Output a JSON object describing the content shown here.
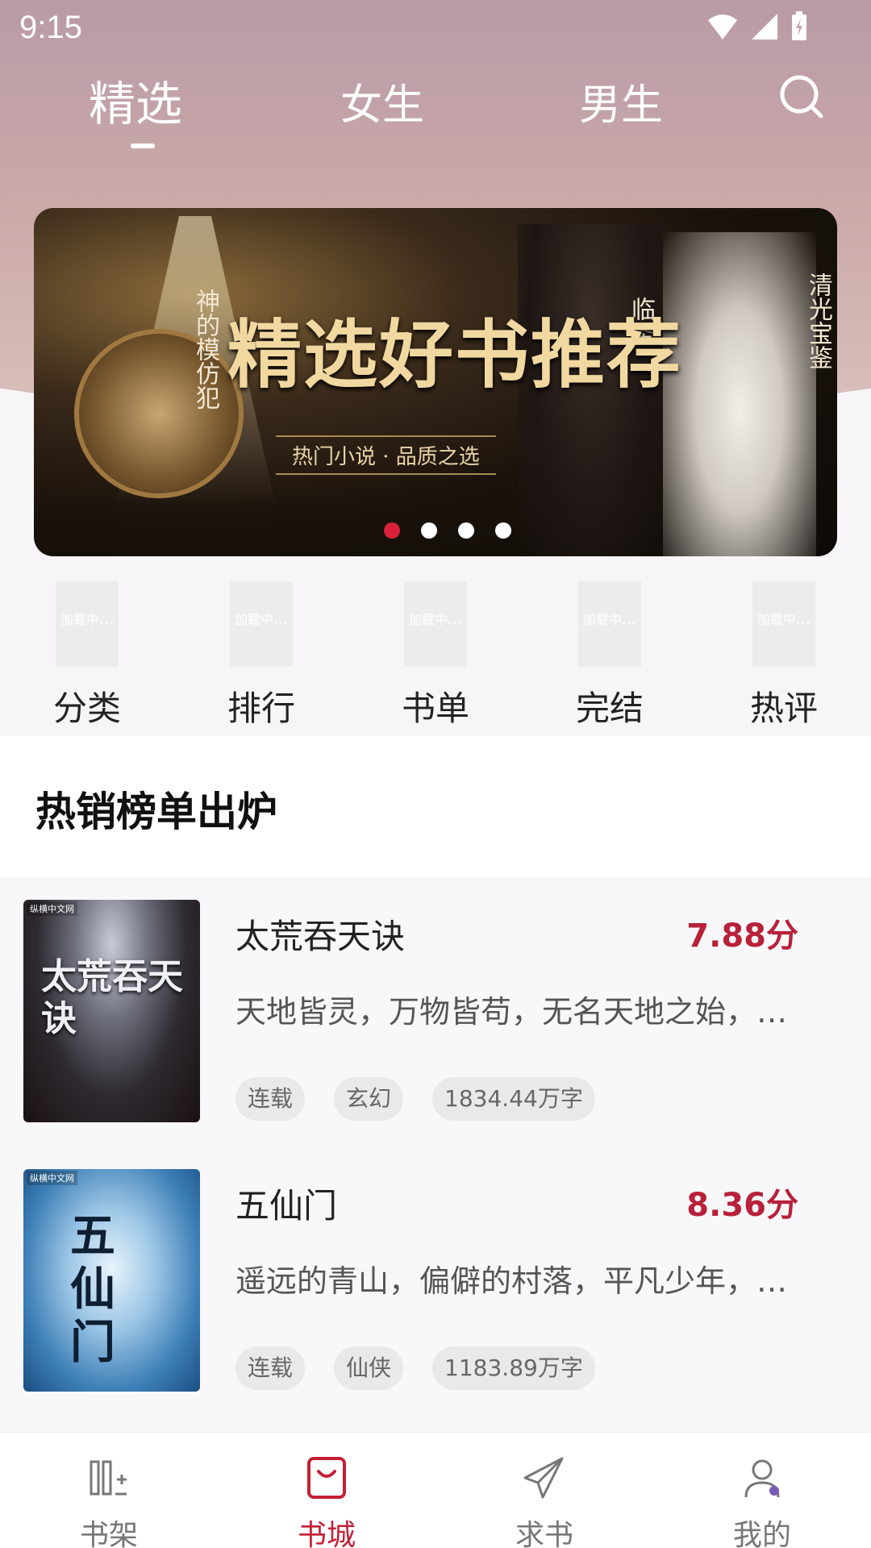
{
  "status_bar": {
    "time": "9:15"
  },
  "top_tabs": [
    "精选",
    "女生",
    "男生"
  ],
  "active_tab": "精选",
  "banner": {
    "title": "精选好书推荐",
    "subtitle": "热门小说 · 品质之选",
    "side_titles": [
      "神的模仿犯",
      "临圣",
      "清光宝鉴"
    ],
    "dots": 4,
    "active_dot": 0
  },
  "quick_nav": [
    {
      "label": "分类",
      "icon_text": "加载中..."
    },
    {
      "label": "排行",
      "icon_text": "加载中..."
    },
    {
      "label": "书单",
      "icon_text": "加载中..."
    },
    {
      "label": "完结",
      "icon_text": "加载中..."
    },
    {
      "label": "热评",
      "icon_text": "加载中..."
    }
  ],
  "section": {
    "title": "热销榜单出炉"
  },
  "books": [
    {
      "title": "太荒吞天诀",
      "score": "7.88分",
      "description": "天地皆灵，万物皆苟，无名天地之始，有名万物之母……",
      "tags": [
        "连载",
        "玄幻",
        "1834.44万字"
      ],
      "cover_text": "太荒吞天诀",
      "cover_logo": "纵横中文网"
    },
    {
      "title": "五仙门",
      "score": "8.36分",
      "description": "遥远的青山，偏僻的村落，平凡少年，踏上仙途……",
      "tags": [
        "连载",
        "仙侠",
        "1183.89万字"
      ],
      "cover_text": "五仙门",
      "cover_logo": "纵横中文网"
    }
  ],
  "bottom_nav": [
    {
      "label": "书架",
      "icon": "bookshelf-icon"
    },
    {
      "label": "书城",
      "icon": "bookstore-bag-icon"
    },
    {
      "label": "求书",
      "icon": "paper-plane-icon"
    },
    {
      "label": "我的",
      "icon": "user-profile-icon"
    }
  ],
  "active_nav": "书城",
  "colors": {
    "accent": "#c42035",
    "score": "#b8213a",
    "header_top": "#b99ba6",
    "header_bottom": "#dcc3bf"
  }
}
